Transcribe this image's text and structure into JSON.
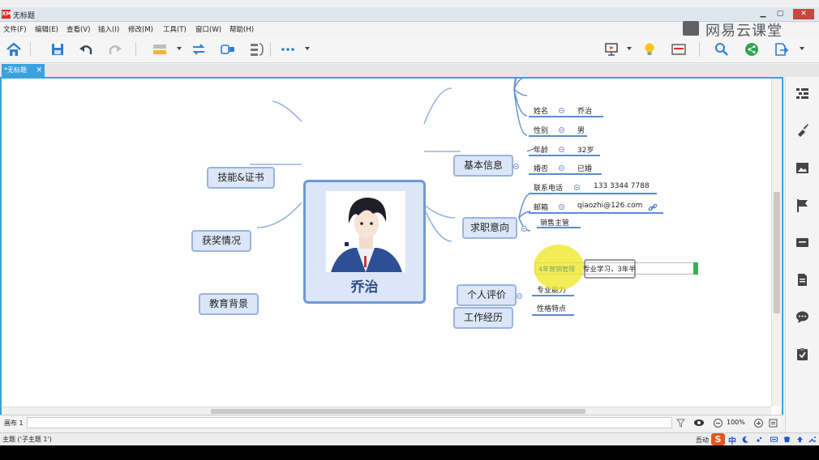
{
  "window": {
    "title": "无标题",
    "app_logo": "XM"
  },
  "menu": [
    "文件(F)",
    "编辑(E)",
    "查看(V)",
    "插入(I)",
    "修改(M)",
    "工具(T)",
    "窗口(W)",
    "帮助(H)"
  ],
  "brand": {
    "text": "网易云课堂"
  },
  "tab": {
    "label": "*无标题",
    "close": "✕"
  },
  "mindmap": {
    "central": {
      "name": "乔治"
    },
    "left_topics": [
      "技能&证书",
      "获奖情况",
      "教育背景"
    ],
    "basic_info": {
      "label": "基本信息",
      "rows": [
        {
          "key": "姓名",
          "value": "乔治"
        },
        {
          "key": "性别",
          "value": "男"
        },
        {
          "key": "年龄",
          "value": "32岁"
        },
        {
          "key": "婚否",
          "value": "已婚"
        },
        {
          "key": "联系电话",
          "value": "133 3344 7788"
        },
        {
          "key": "邮箱",
          "value": "qiaozhi@126.com"
        }
      ]
    },
    "job_intent": {
      "label": "求职意向",
      "value": "销售主管"
    },
    "self_eval": {
      "label": "个人评价",
      "items": [
        "专业能力",
        "性格特点"
      ],
      "edit_old": "4年营销管理",
      "edit_new": "专业学习，3年半"
    },
    "work": {
      "label": "工作经历"
    }
  },
  "pagebar": {
    "sheet": "画布 1",
    "zoom": "100%"
  },
  "statusbar": {
    "text": "主题 ('子主题 1')",
    "ime_label": "吾动",
    "ime_logo": "S",
    "ime_mode": "中"
  },
  "colors": {
    "accent": "#3aa1e0",
    "topic_fill": "#dbe6f8",
    "topic_border": "#98b4e0",
    "branch_line": "#5b8bd0"
  }
}
